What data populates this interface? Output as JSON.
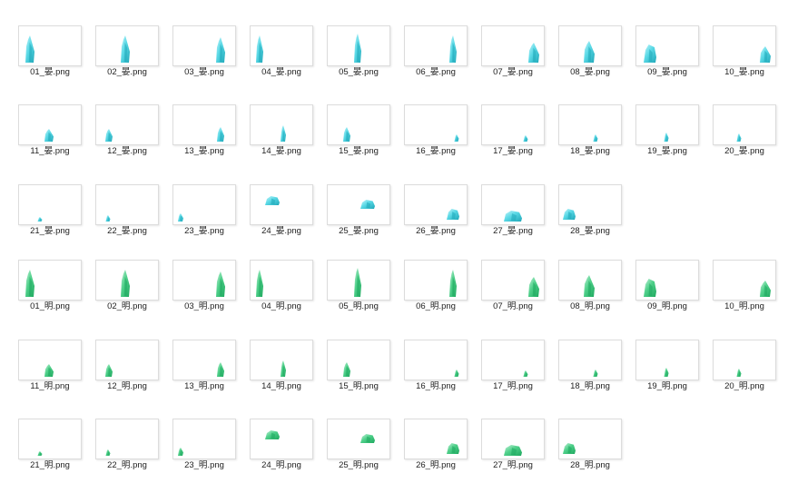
{
  "colors": {
    "blue_crystal": [
      "#1fa7b8",
      "#5ad9e6",
      "#c9f6fb"
    ],
    "green_crystal": [
      "#1ea85e",
      "#4fd08a",
      "#c9f3dd"
    ]
  },
  "groups": [
    {
      "name": "blue",
      "files": [
        "01_晏.png",
        "02_晏.png",
        "03_晏.png",
        "04_晏.png",
        "05_晏.png",
        "06_晏.png",
        "07_晏.png",
        "08_晏.png",
        "09_晏.png",
        "10_晏.png",
        "11_晏.png",
        "12_晏.png",
        "13_晏.png",
        "14_晏.png",
        "15_晏.png",
        "16_晏.png",
        "17_晏.png",
        "18_晏.png",
        "19_晏.png",
        "20_晏.png",
        "21_晏.png",
        "22_晏.png",
        "23_晏.png",
        "24_晏.png",
        "25_晏.png",
        "26_晏.png",
        "27_晏.png",
        "28_晏.png"
      ]
    },
    {
      "name": "green",
      "files": [
        "01_明.png",
        "02_明.png",
        "03_明.png",
        "04_明.png",
        "05_明.png",
        "06_明.png",
        "07_明.png",
        "08_明.png",
        "09_明.png",
        "10_明.png",
        "11_明.png",
        "12_明.png",
        "13_明.png",
        "14_明.png",
        "15_明.png",
        "16_明.png",
        "17_明.png",
        "18_明.png",
        "19_明.png",
        "20_明.png",
        "21_明.png",
        "22_明.png",
        "23_明.png",
        "24_明.png",
        "25_明.png",
        "26_明.png",
        "27_明.png",
        "28_明.png"
      ]
    }
  ]
}
